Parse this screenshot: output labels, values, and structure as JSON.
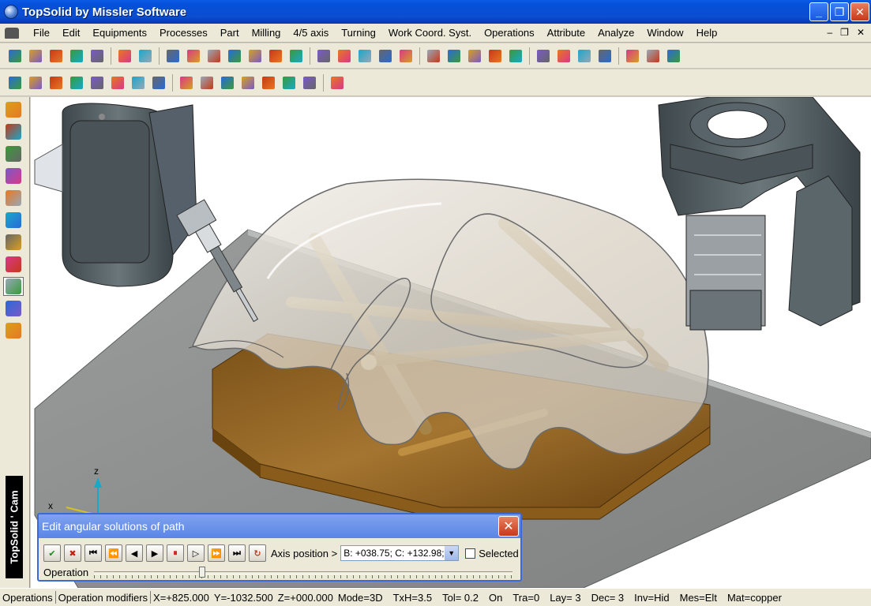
{
  "window": {
    "title": "TopSolid by Missler Software"
  },
  "menu": {
    "items": [
      "File",
      "Edit",
      "Equipments",
      "Processes",
      "Part",
      "Milling",
      "4/5 axis",
      "Turning",
      "Work Coord. Syst.",
      "Operations",
      "Attribute",
      "Analyze",
      "Window",
      "Help"
    ]
  },
  "toolbar1": {
    "icons": [
      "new-icon",
      "open-icon",
      "save-icon",
      "info-icon",
      "print-icon",
      "delete-icon",
      "undo-icon",
      "layer-icon",
      "eraser-icon",
      "measure-icon",
      "paint-icon",
      "tool-icon",
      "view-icon",
      "move-icon",
      "line-tool-icon",
      "cross-icon",
      "stack-icon",
      "bend-icon",
      "dimension-icon",
      "zoom-icon",
      "fit-icon",
      "pan-icon",
      "color-icon",
      "probe-icon",
      "color-swatch-icon",
      "point-icon",
      "line-style-icon",
      "hatch-icon",
      "table-icon",
      "grid-icon",
      "flag-icon"
    ]
  },
  "toolbar2": {
    "icons": [
      "cam-op-1-icon",
      "cam-op-2-icon",
      "cam-op-3-icon",
      "cam-op-4-icon",
      "cam-op-5-icon",
      "cam-op-6-icon",
      "cam-op-7-icon",
      "cam-op-8-icon",
      "stock-icon",
      "sim-icon",
      "block-icon",
      "path-1-icon",
      "path-2-icon",
      "path-3-icon",
      "check-icon",
      "pipe-icon"
    ]
  },
  "leftbar": {
    "icons": [
      "pencil-icon",
      "curve-icon",
      "solid-icon",
      "edit-icon",
      "drill-icon",
      "layer-tool-icon",
      "machine-icon",
      "cube-icon",
      "cam-icon",
      "robot-icon",
      "part-icon"
    ],
    "brand": "TopSolid ' Cam"
  },
  "viewport": {
    "axes": {
      "z": "z",
      "x": "x"
    }
  },
  "dialog": {
    "title": "Edit angular solutions of path",
    "axis_label": "Axis position >",
    "axis_value": "B: +038.75; C: +132.98;",
    "selected_label": "Selected",
    "operation_label": "Operation",
    "slider_position": 0.25
  },
  "status": {
    "segments": [
      "Operations",
      "Operation modifiers",
      "X=+825.000",
      "Y=-1032.500",
      "Z=+000.000",
      "Mode=3D",
      "TxH=3.5",
      "Tol=  0.2",
      "On",
      "Tra=0",
      "Lay=  3",
      "Dec= 3",
      "Inv=Hid",
      "Mes=Elt",
      "Mat=copper"
    ]
  },
  "colors": {
    "title_blue": "#0650d8",
    "plate_gray": "#8c8f8e",
    "wood": "#a0702a",
    "dome": "#d8d2c8",
    "machine": "#5a666a"
  }
}
